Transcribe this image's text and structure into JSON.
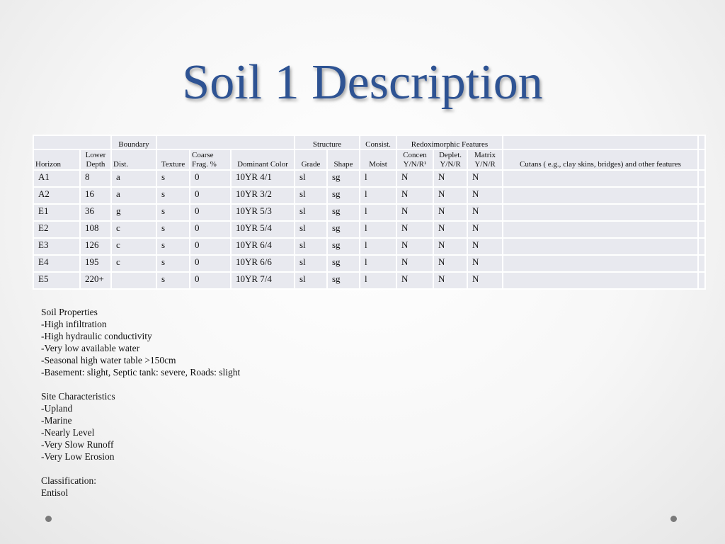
{
  "title": "Soil 1 Description",
  "table": {
    "header1": {
      "boundary": "Boundary",
      "structure": "Structure",
      "consist": "Consist.",
      "redox": "Redoximorphic Features"
    },
    "header2": {
      "horizon": "Horizon",
      "lower_depth_1": "Lower",
      "lower_depth_2": "Depth",
      "dist": "Dist.",
      "texture": "Texture",
      "coarse_1": "Coarse",
      "coarse_2": "Frag. %",
      "dominant_color": "Dominant Color",
      "grade": "Grade",
      "shape": "Shape",
      "moist": "Moist",
      "concen_1": "Concen",
      "concen_2": "Y/N/R¹",
      "deplet_1": "Deplet.",
      "deplet_2": "Y/N/R",
      "matrix_1": "Matrix",
      "matrix_2": "Y/N/R",
      "cutans": "Cutans ( e.g., clay skins, bridges) and other features"
    },
    "rows": [
      [
        "A1",
        "8",
        "a",
        "s",
        "0",
        "10YR 4/1",
        "sl",
        "sg",
        "l",
        "N",
        "N",
        "N",
        ""
      ],
      [
        "A2",
        "16",
        "a",
        "s",
        "0",
        "10YR 3/2",
        "sl",
        "sg",
        "l",
        "N",
        "N",
        "N",
        ""
      ],
      [
        "E1",
        "36",
        "g",
        "s",
        "0",
        "10YR 5/3",
        "sl",
        "sg",
        "l",
        "N",
        "N",
        "N",
        ""
      ],
      [
        "E2",
        "108",
        "c",
        "s",
        "0",
        "10YR 5/4",
        "sl",
        "sg",
        "l",
        "N",
        "N",
        "N",
        ""
      ],
      [
        "E3",
        "126",
        "c",
        "s",
        "0",
        "10YR 6/4",
        "sl",
        "sg",
        "l",
        "N",
        "N",
        "N",
        ""
      ],
      [
        "E4",
        "195",
        "c",
        "s",
        "0",
        "10YR 6/6",
        "sl",
        "sg",
        "l",
        "N",
        "N",
        "N",
        ""
      ],
      [
        "E5",
        "220+",
        "",
        "s",
        "0",
        "10YR 7/4",
        "sl",
        "sg",
        "l",
        "N",
        "N",
        "N",
        ""
      ]
    ]
  },
  "notes": [
    "Soil Properties",
    "-High infiltration",
    "-High hydraulic conductivity",
    "-Very low available water",
    "-Seasonal high water table >150cm",
    "-Basement: slight, Septic tank: severe, Roads: slight",
    "",
    "Site Characteristics",
    "-Upland",
    "-Marine",
    "-Nearly Level",
    "-Very Slow Runoff",
    "-Very Low Erosion",
    "",
    "Classification:",
    "Entisol"
  ],
  "colors": {
    "title": "#2e5393",
    "cell_bg": "#e8e9ef",
    "bullet": "#7a7a7a"
  }
}
